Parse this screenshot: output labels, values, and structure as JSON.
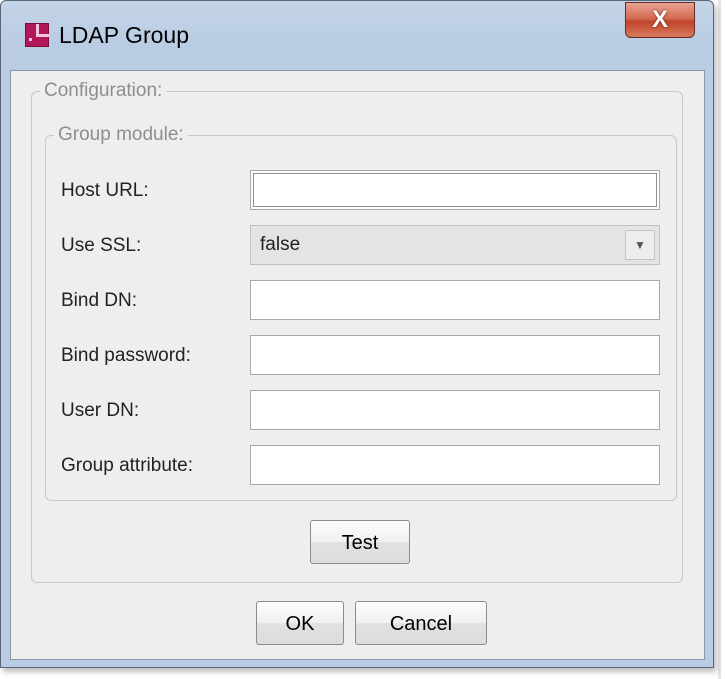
{
  "window": {
    "title": "LDAP Group",
    "close_label": "X"
  },
  "configuration": {
    "legend": "Configuration:",
    "group_module": {
      "legend": "Group module:",
      "fields": {
        "host_url": {
          "label": "Host URL:",
          "value": ""
        },
        "use_ssl": {
          "label": "Use SSL:",
          "value": "false"
        },
        "bind_dn": {
          "label": "Bind DN:",
          "value": ""
        },
        "bind_password": {
          "label": "Bind password:",
          "value": ""
        },
        "user_dn": {
          "label": "User DN:",
          "value": ""
        },
        "group_attribute": {
          "label": "Group attribute:",
          "value": ""
        }
      }
    },
    "test_label": "Test"
  },
  "footer": {
    "ok_label": "OK",
    "cancel_label": "Cancel"
  },
  "icons": {
    "app": "ldap-app-icon",
    "close": "close-icon",
    "dropdown": "chevron-down-icon"
  }
}
